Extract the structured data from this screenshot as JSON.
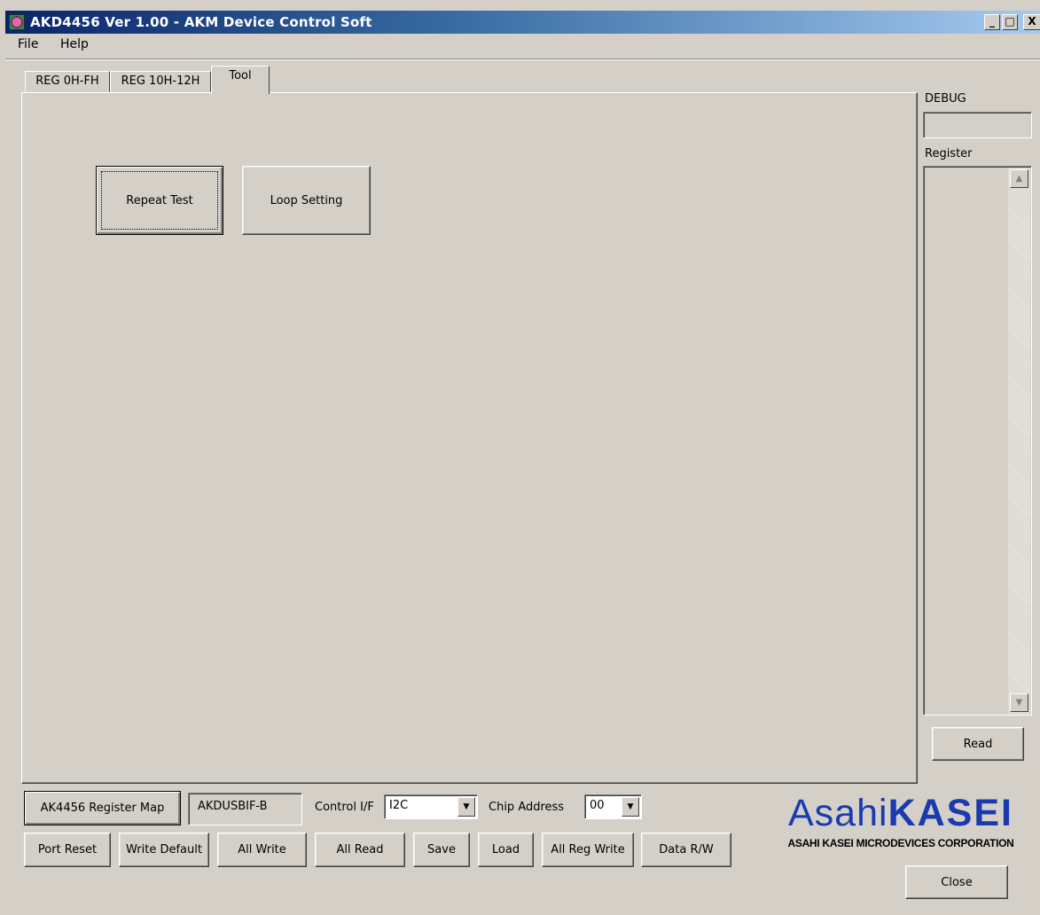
{
  "window": {
    "title": "AKD4456 Ver 1.00 - AKM Device Control Soft",
    "caption_buttons": {
      "minimize": "_",
      "maximize": "□",
      "close": "X"
    }
  },
  "menu": {
    "items": [
      "File",
      "Help"
    ]
  },
  "tabs": [
    {
      "label": "REG 0H-FH",
      "selected": false
    },
    {
      "label": "REG 10H-12H",
      "selected": false
    },
    {
      "label": "Tool",
      "selected": true
    }
  ],
  "tool_panel": {
    "repeat_test": "Repeat Test",
    "loop_setting": "Loop Setting"
  },
  "side_panel": {
    "debug_label": "DEBUG",
    "debug_value": "",
    "register_label": "Register",
    "read": "Read"
  },
  "bottom": {
    "register_map": "AK4456 Register Map",
    "board_name": "AKDUSBIF-B",
    "control_if_label": "Control I/F",
    "control_if_value": "I2C",
    "chip_address_label": "Chip Address",
    "chip_address_value": "00",
    "buttons": {
      "port_reset": "Port Reset",
      "write_default": "Write Default",
      "all_write": "All Write",
      "all_read": "All Read",
      "save": "Save",
      "load": "Load",
      "all_reg_write": "All Reg Write",
      "data_rw": "Data R/W"
    },
    "close": "Close"
  },
  "logo": {
    "brand_part1": "Asahi",
    "brand_part2": "KASEI",
    "subtitle": "ASAHI KASEI MICRODEVICES CORPORATION",
    "color": "#1a3bb0"
  }
}
